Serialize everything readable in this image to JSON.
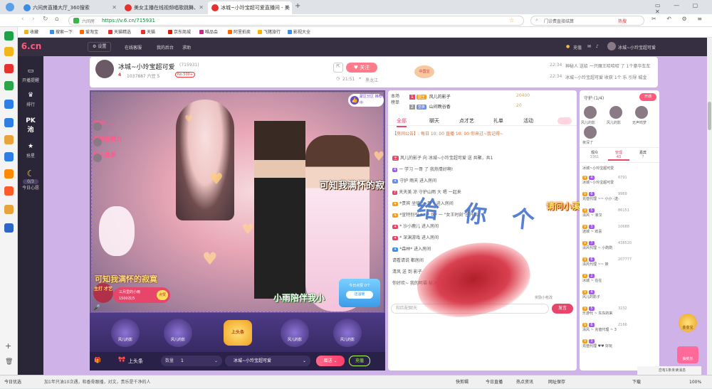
{
  "browser": {
    "tabs": [
      {
        "title": "六间房直播大厅_360搜索",
        "active": false,
        "color": "#3a8ee6"
      },
      {
        "title": "美女主播在线视频唱歌跳舞、",
        "active": false,
        "color": "#e6322e"
      },
      {
        "title": "冰城~小玲宝超可爱直播间 - 美",
        "active": true,
        "color": "#e6322e"
      }
    ],
    "new_tab": "+",
    "url_site": "六间房",
    "url": "https://v.6.cn/715931",
    "search_placeholder": "门诊费直接结算",
    "search_hot": "热搜",
    "bookmarks": [
      "收藏",
      "搜索一下",
      "爱淘宝",
      "天猫精选",
      "天猫",
      "京东商城",
      "唯品会",
      "阿里拍卖",
      "飞猪旅行",
      "影视大全"
    ]
  },
  "site": {
    "logo": "6.cn",
    "logo_sub": "六间房",
    "nav": [
      "设置",
      "在线客服",
      "我的后台",
      "求助"
    ],
    "top_right": {
      "recharge": "充值",
      "room_user": "冰城~小玲宝超可爱"
    },
    "leftnav": [
      {
        "label": "开播提醒",
        "icon": "▭"
      },
      {
        "label": "排行",
        "icon": "♛"
      },
      {
        "label": "PK\n池",
        "icon": ""
      },
      {
        "label": "抢星",
        "icon": "★"
      },
      {
        "label": "今日心愿",
        "icon": "☾"
      }
    ],
    "leftnav_badge": "0/3"
  },
  "anchor": {
    "name": "冰城~小玲宝超可爱",
    "room_id": "(715931)",
    "level": "4",
    "fans": "1037887 六豆 5",
    "rank_badge": "No.500+",
    "time": "21:51",
    "location": "黑龙江",
    "follow": "关注",
    "badge": "中国宝",
    "broadcasts": [
      {
        "time": "22:34",
        "text": "神秘人 送给 一只魔王哈哈哈 了 1个豪华车车"
      },
      {
        "time": "22:34",
        "text": "冰城~小玲宝超可爱 收获 1个 乐 引导 城金"
      }
    ]
  },
  "video": {
    "overlay_top": "最近节目",
    "overlay_left": "可知我满怀的寂寞",
    "overlay_mid": "可知我满怀的寂寞",
    "overlay_bottom": "小雨陪伴我小",
    "overlay_right_title": "请问小溪谁带我追寻",
    "handwriting": "给 你 个",
    "left_tags": [
      "守护……",
      "真情话努力",
      "有人话多"
    ],
    "corner_badge": "蒙区分区 推荐中",
    "corner_label": "主打 才艺",
    "stamp_title": "三月里的小雨",
    "stamp_count": "1500次/5",
    "stamp_button": "点赞",
    "promo": {
      "title": "今日点赞 0个",
      "button": "送温暖"
    },
    "gifts": [
      "风儿的影",
      "风儿的影",
      "上头条",
      "风儿的影",
      "风儿的影"
    ],
    "send_bar": {
      "label": "上头条",
      "qty_label": "数量",
      "qty": "1",
      "to": "冰城~小玲宝超可爱",
      "send": "赠送",
      "recharge": "充值"
    }
  },
  "chat": {
    "rank_tabs": [
      "本场",
      "榜单"
    ],
    "rank": [
      {
        "pos": "1",
        "badge": "国王",
        "name": "风儿的影子",
        "score": "20400"
      },
      {
        "pos": "2",
        "badge": "皇族",
        "name": "山间晚谷香",
        "score": "20"
      }
    ],
    "tabs": [
      "全部",
      "聊天",
      "点才艺",
      "礼单",
      "活动"
    ],
    "notice": "【房间公告】: 每日 10: 00 直播 10: 00 你来过~我记得~",
    "messages": [
      "风儿的影子 向 冰城~小玲宝超可爱 送 共聚，共1",
      "一 学习 一哥 了 我热情好啊!",
      "守护 雨天 进入房间",
      "天天美 凉 守护山雨 大 嗯 一起来",
      "*贵宾 坐骑 一 哥 * 进入房间",
      "*宣特别引 * * * 伙* 一 \"女王时刻\"已开启,",
      "* 沙小鹿儿 进入房间",
      "* 深渊游戏 进入房间",
      "*森林* 进入房间",
      "请看请说 都房间",
      "清风 送 到 影子",
      "你好欢~ 我的阿福 秘决定，秒晨轻松升人"
    ],
    "input_placeholder": "和匹配聊天",
    "send": "发言",
    "chip": "奖励小枪改"
  },
  "guard": {
    "title": "守护 (1/4)",
    "open_btn": "开通",
    "guards": [
      "风儿的影",
      "风儿的影",
      "无声鸣梦",
      "夜深了"
    ],
    "tabs": [
      {
        "label": "观众",
        "count": "3361"
      },
      {
        "label": "管理",
        "count": "43"
      },
      {
        "label": "嘉宾",
        "count": "7"
      }
    ],
    "top_user": "冰城~小玲宝超可爱",
    "users": [
      {
        "name": "冰城~小玲宝超可爱",
        "score": "6791"
      },
      {
        "name": "充值代理 ~~ 小小 -送-",
        "score": "9969"
      },
      {
        "name": "清风 ~ 浪汉",
        "score": "86151"
      },
      {
        "name": "迷城 ~ 欢喜",
        "score": "10688"
      },
      {
        "name": "清风代理 ~ 小酌酌",
        "score": "438520"
      },
      {
        "name": "清风代理 ~~ 妹",
        "score": "207777"
      },
      {
        "name": "冰城 ~ 在在",
        "score": ""
      },
      {
        "name": "风儿的影子",
        "score": ""
      },
      {
        "name": "乐游代 ~ 东东的来",
        "score": "3232"
      },
      {
        "name": "清风 ~ 充值代理 ~ 3",
        "score": "2166"
      },
      {
        "name": "充值代理 ♥♥ 好玩",
        "score": ""
      }
    ],
    "chip": "恋有1条未读消息"
  },
  "right_floats": {
    "gold": "金金宝",
    "shop": "抽奖乐"
  },
  "statusbar": {
    "left": "今日优选",
    "news": "加1年只油10次遇，和香骨跟播，对文，贵乐是千净的人",
    "items": [
      "快剪辑",
      "今日直播",
      "热点资讯",
      "网址保存",
      "下载"
    ],
    "zoom": "100%"
  },
  "colors": {
    "accent": "#ff5a7a",
    "purple": "#8b53d6",
    "nav": "#352f41"
  }
}
